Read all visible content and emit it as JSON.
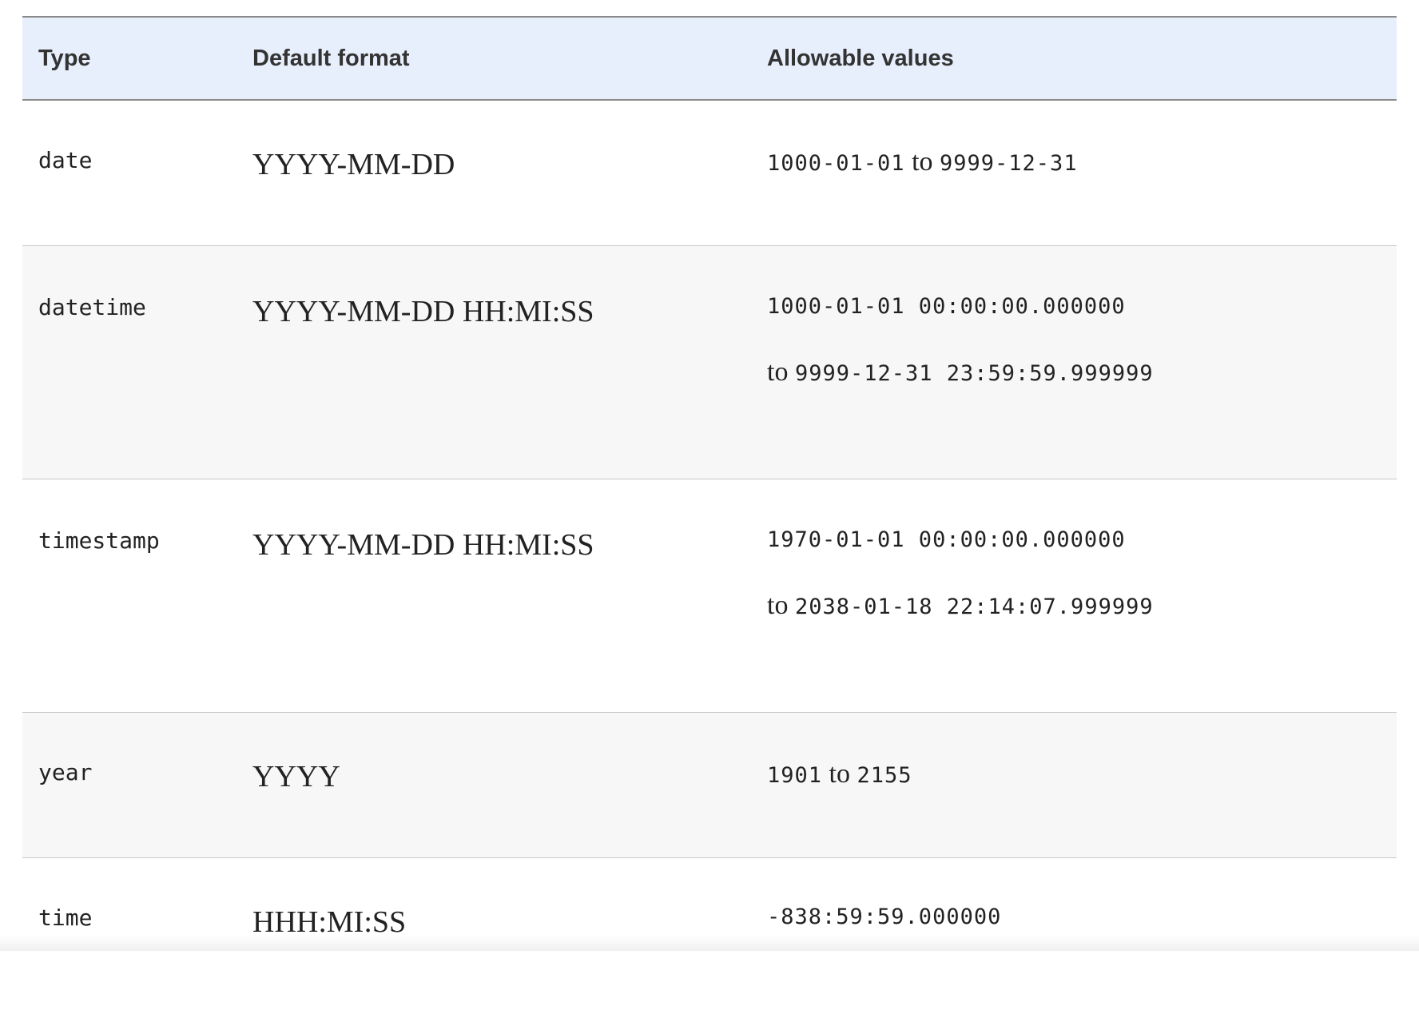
{
  "header": {
    "type": "Type",
    "default_format": "Default format",
    "allowable_values": "Allowable values"
  },
  "rows": [
    {
      "type": "date",
      "format": "YYYY-MM-DD",
      "values_line1": {
        "start": "1000-01-01",
        "mid": " to ",
        "end": "9999-12-31"
      }
    },
    {
      "type": "datetime",
      "format": "YYYY-MM-DD HH:MI:SS",
      "values_line1": "1000-01-01 00:00:00.000000",
      "values_line2": {
        "prefix": "to ",
        "value": "9999-12-31 23:59:59.999999"
      }
    },
    {
      "type": "timestamp",
      "format": "YYYY-MM-DD HH:MI:SS",
      "values_line1": "1970-01-01 00:00:00.000000",
      "values_line2": {
        "prefix": "to ",
        "value": "2038-01-18 22:14:07.999999"
      }
    },
    {
      "type": "year",
      "format": "YYYY",
      "values_line1": {
        "start": "1901",
        "mid": " to ",
        "end": "2155"
      }
    },
    {
      "type": "time",
      "format": "HHH:MI:SS",
      "values_line1": "-838:59:59.000000"
    }
  ]
}
